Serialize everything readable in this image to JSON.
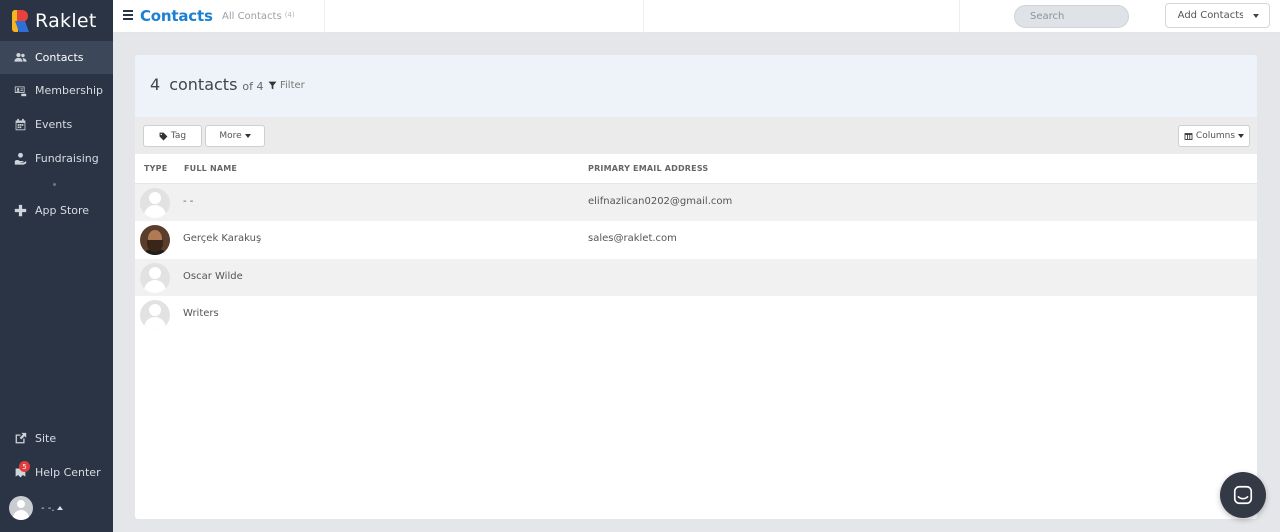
{
  "app": {
    "name": "Raklet"
  },
  "sidebar": {
    "items": [
      {
        "label": "Contacts",
        "icon": "users-icon",
        "active": true
      },
      {
        "label": "Membership",
        "icon": "id-card-icon"
      },
      {
        "label": "Events",
        "icon": "calendar-icon"
      },
      {
        "label": "Fundraising",
        "icon": "hand-coins-icon"
      },
      {
        "label": "App Store",
        "icon": "plus-icon"
      }
    ],
    "bottom": [
      {
        "label": "Site",
        "icon": "external-link-icon"
      },
      {
        "label": "Help Center",
        "icon": "help-icon",
        "badge": "5"
      }
    ],
    "user": {
      "name": "- -."
    }
  },
  "topbar": {
    "title": "Contacts",
    "breadcrumb": "All Contacts",
    "breadcrumb_count": "(4)",
    "search_placeholder": "Search",
    "add_label": "Add Contacts"
  },
  "panel": {
    "count": "4",
    "count_label": "contacts",
    "of_label": "of 4",
    "filter_label": "Filter",
    "toolbar": {
      "tag_label": "Tag",
      "more_label": "More",
      "columns_label": "Columns"
    },
    "columns": [
      "TYPE",
      "FULL NAME",
      "PRIMARY EMAIL ADDRESS"
    ],
    "rows": [
      {
        "name": "- -",
        "email": "elifnazlican0202@gmail.com",
        "avatar": "placeholder"
      },
      {
        "name": "Gerçek Karakuş",
        "email": "sales@raklet.com",
        "avatar": "photo"
      },
      {
        "name": "Oscar Wilde",
        "email": "",
        "avatar": "placeholder"
      },
      {
        "name": "Writers",
        "email": "",
        "avatar": "placeholder"
      }
    ]
  },
  "colors": {
    "sidebar": "#2a3444",
    "accent": "#1d7fd1",
    "badge": "#e23b3b"
  }
}
